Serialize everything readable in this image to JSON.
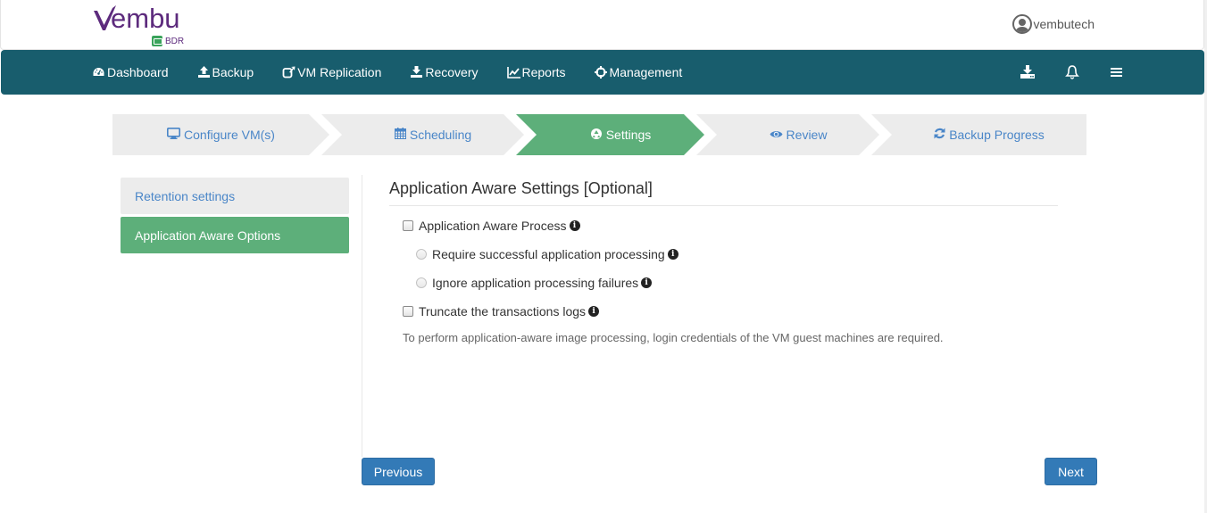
{
  "brand": {
    "name_rest": "embu",
    "product": "BDR",
    "color": "#5d2b7d"
  },
  "user": {
    "name": "vembutech",
    "icon": "user-circle-icon"
  },
  "nav": {
    "items": [
      {
        "label": "Dashboard",
        "icon": "dashboard-icon"
      },
      {
        "label": "Backup",
        "icon": "upload-icon"
      },
      {
        "label": "VM Replication",
        "icon": "share-square-icon"
      },
      {
        "label": "Recovery",
        "icon": "download-icon"
      },
      {
        "label": "Reports",
        "icon": "line-chart-icon"
      },
      {
        "label": "Management",
        "icon": "crosshairs-icon"
      }
    ],
    "right_icons": [
      "download-tray-icon",
      "bell-icon",
      "hamburger-menu-icon"
    ],
    "background": "#185d6d"
  },
  "wizard": {
    "steps": [
      {
        "label": "Configure VM(s)",
        "icon": "desktop-icon",
        "active": false
      },
      {
        "label": "Scheduling",
        "icon": "calendar-icon",
        "active": false
      },
      {
        "label": "Settings",
        "icon": "recycle-icon",
        "active": true
      },
      {
        "label": "Review",
        "icon": "eye-icon",
        "active": false
      },
      {
        "label": "Backup Progress",
        "icon": "refresh-icon",
        "active": false
      }
    ],
    "active_color": "#5daf7a",
    "inactive_color": "#ececec"
  },
  "side_menu": {
    "items": [
      {
        "label": "Retention settings",
        "active": false
      },
      {
        "label": "Application Aware Options",
        "active": true
      }
    ]
  },
  "content": {
    "title": "Application Aware Settings [Optional]",
    "options": [
      {
        "type": "checkbox",
        "label": "Application Aware Process",
        "checked": false
      },
      {
        "type": "radio",
        "label": "Require successful application processing",
        "checked": false
      },
      {
        "type": "radio",
        "label": "Ignore application processing failures",
        "checked": false
      },
      {
        "type": "checkbox",
        "label": "Truncate the transactions logs",
        "checked": false
      }
    ],
    "info_glyph": "i",
    "note": "To perform application-aware image processing, login credentials of the VM guest machines are required."
  },
  "buttons": {
    "previous": "Previous",
    "next": "Next"
  }
}
